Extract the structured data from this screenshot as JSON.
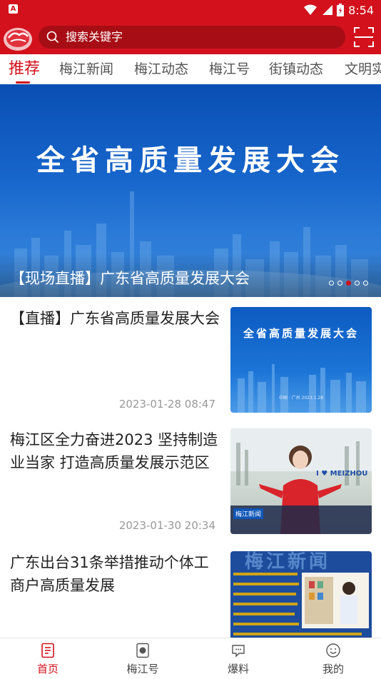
{
  "status_bar": {
    "time": "8:54",
    "app_badge": "A"
  },
  "header": {
    "search_placeholder": "搜索关键字"
  },
  "tabs": [
    "推荐",
    "梅江新闻",
    "梅江动态",
    "梅江号",
    "街镇动态",
    "文明实"
  ],
  "banner": {
    "title": "全省高质量发展大会",
    "caption": "【现场直播】广东省高质量发展大会",
    "dot_count": 5,
    "active_dot": 2
  },
  "news": [
    {
      "title": "【直播】广东省高质量发展大会",
      "time": "2023-01-28 08:47",
      "thumb_title": "全省高质量发展大会",
      "thumb_sub": "中国 · 广州 2023.1.28"
    },
    {
      "title": "梅江区全力奋进2023 坚持制造业当家 打造高质量发展示范区",
      "time": "2023-01-30 20:34",
      "thumb_badge": "梅江新闻",
      "thumb_sign": "I ♥ MEIZHOU"
    },
    {
      "title": "广东出台31条举措推动个体工商户高质量发展",
      "time": "",
      "thumb_header": "梅江新闻"
    }
  ],
  "bottom_nav": [
    {
      "label": "首页",
      "icon": "home-icon",
      "active": true
    },
    {
      "label": "梅江号",
      "icon": "meijianghao-icon",
      "active": false
    },
    {
      "label": "爆料",
      "icon": "chat-icon",
      "active": false
    },
    {
      "label": "我的",
      "icon": "profile-icon",
      "active": false
    }
  ],
  "colors": {
    "brand": "#d2111c",
    "banner": "#1766cc"
  }
}
